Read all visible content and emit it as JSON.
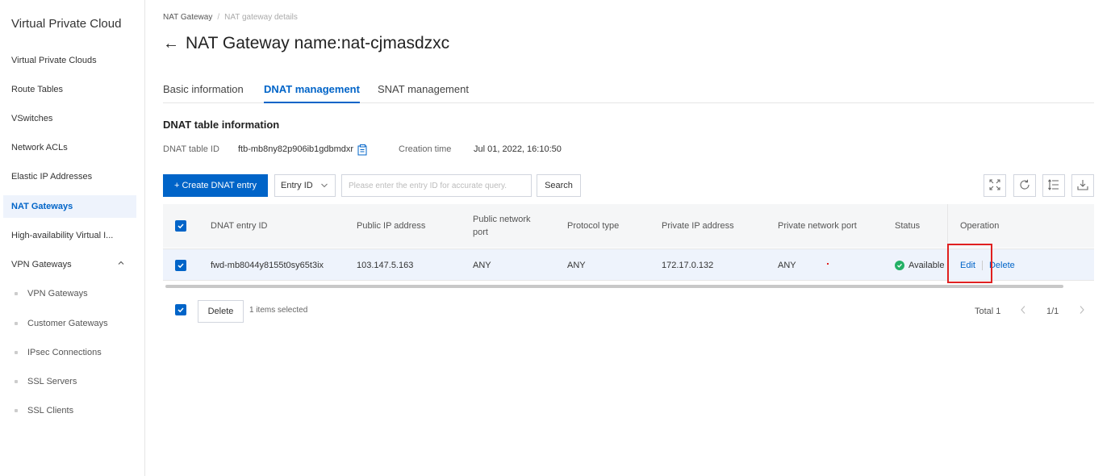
{
  "sidebar": {
    "title": "Virtual Private Cloud",
    "items": [
      {
        "label": "Virtual Private Clouds"
      },
      {
        "label": "Route Tables"
      },
      {
        "label": "VSwitches"
      },
      {
        "label": "Network ACLs"
      },
      {
        "label": "Elastic IP Addresses"
      },
      {
        "label": "NAT Gateways",
        "active": true
      },
      {
        "label": "High-availability Virtual I..."
      },
      {
        "label": "VPN Gateways",
        "expanded": true
      }
    ],
    "subitems": [
      {
        "label": "VPN Gateways"
      },
      {
        "label": "Customer Gateways"
      },
      {
        "label": "IPsec Connections"
      },
      {
        "label": "SSL Servers"
      },
      {
        "label": "SSL Clients"
      }
    ]
  },
  "breadcrumb": {
    "root": "NAT Gateway",
    "separator": "/",
    "current": "NAT gateway details"
  },
  "page": {
    "back_icon": "←",
    "title": "NAT Gateway name:nat-cjmasdzxc"
  },
  "tabs": [
    {
      "label": "Basic information"
    },
    {
      "label": "DNAT management",
      "active": true
    },
    {
      "label": "SNAT management"
    }
  ],
  "section": {
    "title": "DNAT table information",
    "table_id_label": "DNAT table ID",
    "table_id_value": "ftb-mb8ny82p906ib1gdbmdxr",
    "creation_label": "Creation time",
    "creation_value": "Jul 01, 2022, 16:10:50"
  },
  "toolbar": {
    "create_label": "+ Create DNAT entry",
    "filter_label": "Entry ID",
    "search_placeholder": "Please enter the entry ID for accurate query.",
    "search_label": "Search",
    "tools": [
      "fullscreen-icon",
      "refresh-icon",
      "column-settings-icon",
      "download-icon"
    ]
  },
  "table": {
    "columns": [
      "DNAT entry ID",
      "Public IP address",
      "Public network port",
      "Protocol type",
      "Private IP address",
      "Private network port",
      "Status",
      "Operation"
    ],
    "rows": [
      {
        "entry_id": "fwd-mb8044y8155t0sy65t3ix",
        "public_ip": "103.147.5.163",
        "public_port": "ANY",
        "protocol": "ANY",
        "private_ip": "172.17.0.132",
        "private_port": "ANY",
        "status": "Available",
        "edit_label": "Edit",
        "delete_label": "Delete"
      }
    ]
  },
  "footer": {
    "delete_label": "Delete",
    "selected_text": "1 items selected",
    "total_text": "Total 1",
    "page_text": "1/1"
  },
  "colors": {
    "primary": "#0064c8",
    "status_available": "#23b066",
    "highlight": "#e02020"
  }
}
